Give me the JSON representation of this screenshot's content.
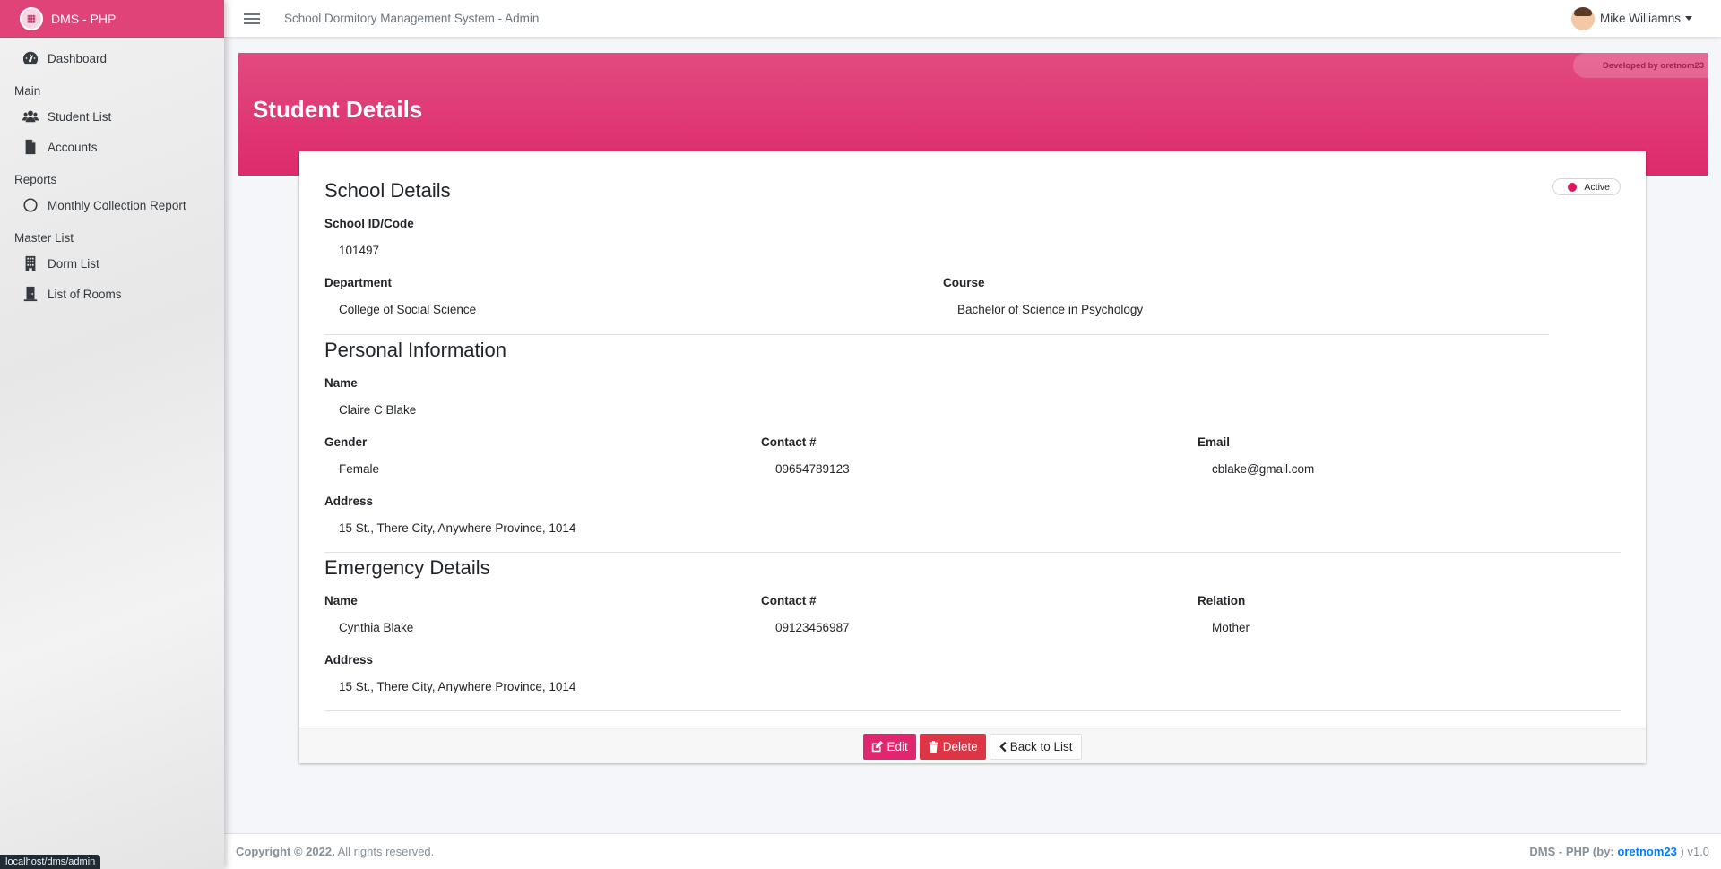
{
  "brand": {
    "name": "DMS - PHP",
    "logo_icon": "dorm-logo-icon"
  },
  "sidebar": {
    "items": [
      {
        "label": "Dashboard",
        "icon": "tachometer-icon"
      }
    ],
    "sections": [
      {
        "header": "Main",
        "items": [
          {
            "label": "Student List",
            "icon": "users-icon"
          },
          {
            "label": "Accounts",
            "icon": "file-icon"
          }
        ]
      },
      {
        "header": "Reports",
        "items": [
          {
            "label": "Monthly Collection Report",
            "icon": "circle-icon"
          }
        ]
      },
      {
        "header": "Master List",
        "items": [
          {
            "label": "Dorm List",
            "icon": "building-icon"
          },
          {
            "label": "List of Rooms",
            "icon": "door-icon"
          }
        ]
      }
    ]
  },
  "status_url": "localhost/dms/admin",
  "topbar": {
    "title": "School Dormitory Management System - Admin",
    "user_name": "Mike Williamns"
  },
  "hero": {
    "title": "Student Details",
    "dev_badge": "Developed by oretnom23"
  },
  "status": {
    "label": "Active",
    "color": "#d81b60"
  },
  "school": {
    "section_title": "School Details",
    "id_label": "School ID/Code",
    "id_value": "101497",
    "department_label": "Department",
    "department_value": "College of Social Science",
    "course_label": "Course",
    "course_value": "Bachelor of Science in Psychology"
  },
  "personal": {
    "section_title": "Personal Information",
    "name_label": "Name",
    "name_value": "Claire C Blake",
    "gender_label": "Gender",
    "gender_value": "Female",
    "contact_label": "Contact #",
    "contact_value": "09654789123",
    "email_label": "Email",
    "email_value": "cblake@gmail.com",
    "address_label": "Address",
    "address_value": "15 St., There City, Anywhere Province, 1014"
  },
  "emergency": {
    "section_title": "Emergency Details",
    "name_label": "Name",
    "name_value": "Cynthia Blake",
    "contact_label": "Contact #",
    "contact_value": "09123456987",
    "relation_label": "Relation",
    "relation_value": "Mother",
    "address_label": "Address",
    "address_value": "15 St., There City, Anywhere Province, 1014"
  },
  "actions": {
    "edit_label": "Edit",
    "delete_label": "Delete",
    "back_label": "Back to List"
  },
  "footer": {
    "copyright": "Copyright © 2022.",
    "rights": "All rights reserved.",
    "app_prefix": "DMS - PHP (by:",
    "author": "oretnom23",
    "version_suffix": ") v1.0"
  },
  "colors": {
    "accent": "#e04378",
    "edit": "#e0266f",
    "delete": "#dc3545"
  }
}
